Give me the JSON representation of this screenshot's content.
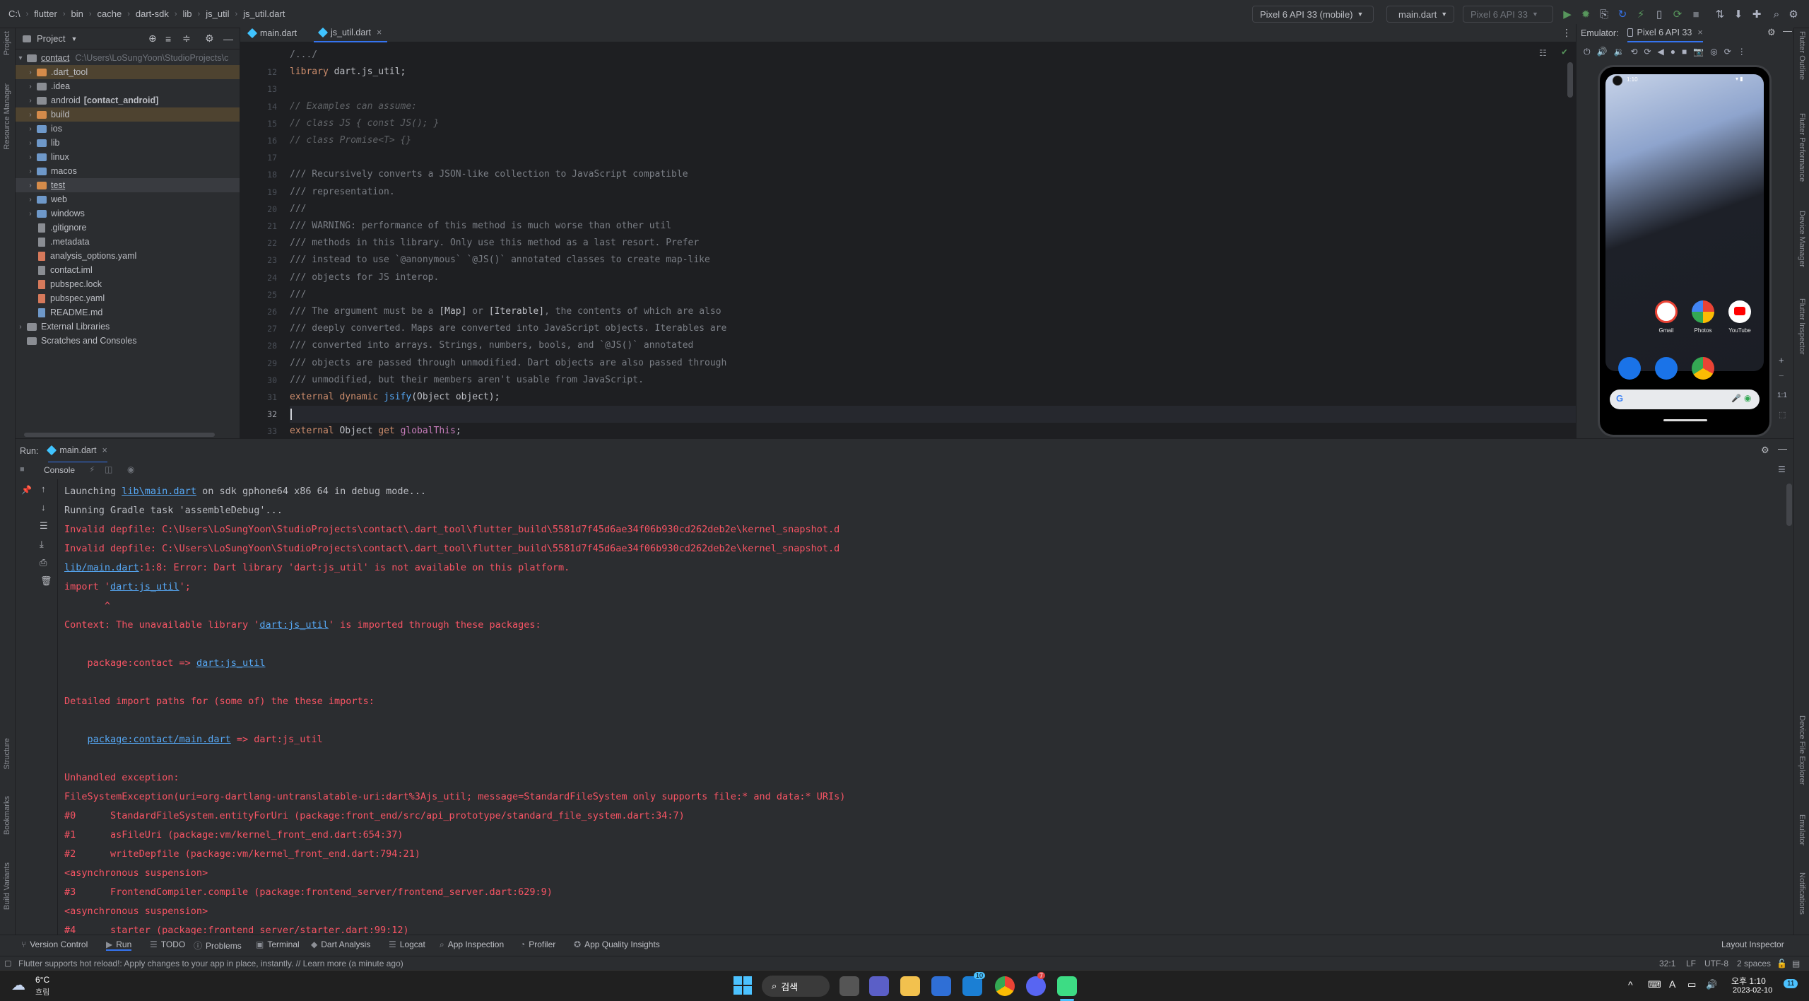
{
  "breadcrumb": [
    "C:\\",
    "flutter",
    "bin",
    "cache",
    "dart-sdk",
    "lib",
    "js_util",
    "js_util.dart"
  ],
  "toolbar": {
    "device": "Pixel 6 API 33 (mobile)",
    "config": "main.dart",
    "avd": "Pixel 6 API 33"
  },
  "left_stripe": [
    "Project",
    "Resource Manager",
    "Structure",
    "Bookmarks",
    "Build Variants"
  ],
  "right_stripe": [
    "Flutter Outline",
    "Flutter Performance",
    "Device Manager",
    "Flutter Inspector",
    "Device File Explorer",
    "Emulator",
    "Notifications"
  ],
  "project": {
    "title": "Project",
    "root": "contact",
    "root_path": "C:\\Users\\LoSungYoon\\StudioProjects\\c",
    "items": [
      {
        "label": ".dart_tool",
        "kind": "folder-orange",
        "expand": true,
        "style": "excluded"
      },
      {
        "label": ".idea",
        "kind": "folder-gray",
        "expand": true
      },
      {
        "label": "android",
        "suffix": "[contact_android]",
        "kind": "folder-gray",
        "expand": true
      },
      {
        "label": "build",
        "kind": "folder-orange",
        "expand": true,
        "style": "excluded"
      },
      {
        "label": "ios",
        "kind": "folder-blue",
        "expand": true
      },
      {
        "label": "lib",
        "kind": "folder-blue",
        "expand": true
      },
      {
        "label": "linux",
        "kind": "folder-blue",
        "expand": true
      },
      {
        "label": "macos",
        "kind": "folder-blue",
        "expand": true
      },
      {
        "label": "test",
        "kind": "folder-orange",
        "expand": true,
        "style": "sel"
      },
      {
        "label": "web",
        "kind": "folder-blue",
        "expand": true
      },
      {
        "label": "windows",
        "kind": "folder-blue",
        "expand": true
      },
      {
        "label": ".gitignore",
        "kind": "file"
      },
      {
        "label": ".metadata",
        "kind": "file"
      },
      {
        "label": "analysis_options.yaml",
        "kind": "file-yaml"
      },
      {
        "label": "contact.iml",
        "kind": "file"
      },
      {
        "label": "pubspec.lock",
        "kind": "file-yaml"
      },
      {
        "label": "pubspec.yaml",
        "kind": "file-yaml"
      },
      {
        "label": "README.md",
        "kind": "file-md"
      }
    ],
    "external": "External Libraries",
    "scratches": "Scratches and Consoles"
  },
  "editor": {
    "tabs": [
      {
        "label": "main.dart",
        "active": false
      },
      {
        "label": "js_util.dart",
        "active": true
      }
    ],
    "lines": [
      {
        "n": "",
        "segs": [
          [
            "cmt",
            "/.../"
          ]
        ]
      },
      {
        "n": "12",
        "segs": [
          [
            "kw",
            "library"
          ],
          [
            "ty",
            " dart.js_util;"
          ]
        ]
      },
      {
        "n": "13",
        "segs": []
      },
      {
        "n": "14",
        "segs": [
          [
            "cmt-i",
            "// Examples can assume:"
          ]
        ]
      },
      {
        "n": "15",
        "segs": [
          [
            "cmt-i",
            "// class JS { const JS(); }"
          ]
        ]
      },
      {
        "n": "16",
        "segs": [
          [
            "cmt-i",
            "// class Promise<T> {}"
          ]
        ]
      },
      {
        "n": "17",
        "segs": []
      },
      {
        "n": "18",
        "segs": [
          [
            "cmt",
            "/// Recursively converts a JSON-like collection to JavaScript compatible"
          ]
        ]
      },
      {
        "n": "19",
        "segs": [
          [
            "cmt",
            "/// representation."
          ]
        ]
      },
      {
        "n": "20",
        "segs": [
          [
            "cmt",
            "///"
          ]
        ]
      },
      {
        "n": "21",
        "segs": [
          [
            "cmt",
            "/// WARNING: performance of this method is much worse than other util"
          ]
        ]
      },
      {
        "n": "22",
        "segs": [
          [
            "cmt",
            "/// methods in this library. Only use this method as a last resort. Prefer"
          ]
        ]
      },
      {
        "n": "23",
        "segs": [
          [
            "cmt",
            "/// instead to use `@anonymous` `@JS()` annotated classes to create map-like"
          ]
        ]
      },
      {
        "n": "24",
        "segs": [
          [
            "cmt",
            "/// objects for JS interop."
          ]
        ]
      },
      {
        "n": "25",
        "segs": [
          [
            "cmt",
            "///"
          ]
        ]
      },
      {
        "n": "26",
        "segs": [
          [
            "cmt",
            "/// The argument must be a "
          ],
          [
            "ty",
            "[Map]"
          ],
          [
            "cmt",
            " or "
          ],
          [
            "ty",
            "[Iterable]"
          ],
          [
            "cmt",
            ", the contents of which are also"
          ]
        ]
      },
      {
        "n": "27",
        "segs": [
          [
            "cmt",
            "/// deeply converted. Maps are converted into JavaScript objects. Iterables are"
          ]
        ]
      },
      {
        "n": "28",
        "segs": [
          [
            "cmt",
            "/// converted into arrays. Strings, numbers, bools, and `@JS()` annotated"
          ]
        ]
      },
      {
        "n": "29",
        "segs": [
          [
            "cmt",
            "/// objects are passed through unmodified. Dart objects are also passed through"
          ]
        ]
      },
      {
        "n": "30",
        "segs": [
          [
            "cmt",
            "/// unmodified, but their members aren't usable from JavaScript."
          ]
        ]
      },
      {
        "n": "31",
        "segs": [
          [
            "kw",
            "external dynamic "
          ],
          [
            "fn",
            "jsify"
          ],
          [
            "ty",
            "(Object object);"
          ]
        ]
      },
      {
        "n": "32",
        "segs": [],
        "caret": true
      },
      {
        "n": "33",
        "segs": [
          [
            "kw",
            "external "
          ],
          [
            "ty",
            "Object "
          ],
          [
            "kw",
            "get "
          ],
          [
            "ref",
            "globalThis"
          ],
          [
            "ty",
            ";"
          ]
        ]
      }
    ]
  },
  "emulator": {
    "title": "Emulator:",
    "tab": "Pixel 6 API 33",
    "status_time": "1:10",
    "apps_row1": [
      {
        "label": "Gmail",
        "color": "#ffffff"
      },
      {
        "label": "Photos",
        "color": "#fbbc04"
      },
      {
        "label": "YouTube",
        "color": "#ff0000"
      }
    ],
    "apps_row2": [
      {
        "label": "",
        "color": "#1a73e8"
      },
      {
        "label": "",
        "color": "#1a73e8"
      },
      {
        "label": "",
        "color": "#ffffff"
      }
    ],
    "zoom_label": "1:1"
  },
  "run": {
    "label": "Run:",
    "tab": "main.dart",
    "console_tab": "Console",
    "lines": [
      {
        "style": "normal",
        "segs": [
          [
            "t",
            "Launching "
          ],
          [
            "lnk",
            "lib\\main.dart"
          ],
          [
            "t",
            " on sdk gphone64 x86 64 in debug mode..."
          ]
        ]
      },
      {
        "style": "normal",
        "segs": [
          [
            "t",
            "Running Gradle task 'assembleDebug'..."
          ]
        ]
      },
      {
        "style": "err",
        "segs": [
          [
            "t",
            "Invalid depfile: C:\\Users\\LoSungYoon\\StudioProjects\\contact\\.dart_tool\\flutter_build\\5581d7f45d6ae34f06b930cd262deb2e\\kernel_snapshot.d"
          ]
        ]
      },
      {
        "style": "err",
        "segs": [
          [
            "t",
            "Invalid depfile: C:\\Users\\LoSungYoon\\StudioProjects\\contact\\.dart_tool\\flutter_build\\5581d7f45d6ae34f06b930cd262deb2e\\kernel_snapshot.d"
          ]
        ]
      },
      {
        "style": "err",
        "segs": [
          [
            "lnk",
            "lib/main.dart"
          ],
          [
            "t",
            ":1:8: Error: Dart library 'dart:js_util' is not available on this platform."
          ]
        ]
      },
      {
        "style": "err",
        "segs": [
          [
            "t",
            "import '"
          ],
          [
            "lnk",
            "dart:js_util"
          ],
          [
            "t",
            "';"
          ]
        ]
      },
      {
        "style": "err",
        "segs": [
          [
            "t",
            "       ^"
          ]
        ]
      },
      {
        "style": "err",
        "segs": [
          [
            "t",
            "Context: The unavailable library '"
          ],
          [
            "lnk",
            "dart:js_util"
          ],
          [
            "t",
            "' is imported through these packages:"
          ]
        ]
      },
      {
        "style": "err",
        "segs": []
      },
      {
        "style": "err",
        "segs": [
          [
            "t",
            "    package:contact => "
          ],
          [
            "lnk",
            "dart:js_util"
          ]
        ]
      },
      {
        "style": "err",
        "segs": []
      },
      {
        "style": "err",
        "segs": [
          [
            "t",
            "Detailed import paths for (some of) the these imports:"
          ]
        ]
      },
      {
        "style": "err",
        "segs": []
      },
      {
        "style": "err",
        "segs": [
          [
            "t",
            "    "
          ],
          [
            "lnk",
            "package:contact/main.dart"
          ],
          [
            "t",
            " => dart:js_util"
          ]
        ]
      },
      {
        "style": "err",
        "segs": []
      },
      {
        "style": "err",
        "segs": [
          [
            "t",
            "Unhandled exception:"
          ]
        ]
      },
      {
        "style": "err",
        "segs": [
          [
            "t",
            "FileSystemException(uri=org-dartlang-untranslatable-uri:dart%3Ajs_util; message=StandardFileSystem only supports file:* and data:* URIs)"
          ]
        ]
      },
      {
        "style": "err",
        "segs": [
          [
            "t",
            "#0      StandardFileSystem.entityForUri (package:front_end/src/api_prototype/standard_file_system.dart:34:7)"
          ]
        ]
      },
      {
        "style": "err",
        "segs": [
          [
            "t",
            "#1      asFileUri (package:vm/kernel_front_end.dart:654:37)"
          ]
        ]
      },
      {
        "style": "err",
        "segs": [
          [
            "t",
            "#2      writeDepfile (package:vm/kernel_front_end.dart:794:21)"
          ]
        ]
      },
      {
        "style": "err",
        "segs": [
          [
            "t",
            "<asynchronous suspension>"
          ]
        ]
      },
      {
        "style": "err",
        "segs": [
          [
            "t",
            "#3      FrontendCompiler.compile (package:frontend_server/frontend_server.dart:629:9)"
          ]
        ]
      },
      {
        "style": "err",
        "segs": [
          [
            "t",
            "<asynchronous suspension>"
          ]
        ]
      },
      {
        "style": "err",
        "segs": [
          [
            "t",
            "#4      starter (package:frontend_server/starter.dart:99:12)"
          ]
        ]
      }
    ]
  },
  "bottom_tools": [
    "Version Control",
    "Run",
    "TODO",
    "Problems",
    "Terminal",
    "Dart Analysis",
    "Logcat",
    "App Inspection",
    "Profiler",
    "App Quality Insights"
  ],
  "layout_inspector": "Layout Inspector",
  "status": {
    "message": "Flutter supports hot reload!: Apply changes to your app in place, instantly. // Learn more (a minute ago)",
    "position": "32:1",
    "line_sep": "LF",
    "encoding": "UTF-8",
    "indent": "2 spaces"
  },
  "taskbar": {
    "weather_temp": "6°C",
    "weather_desc": "흐림",
    "search": "검색",
    "badge_mail": "10",
    "badge_discord": "7",
    "time": "오후 1:10",
    "date": "2023-02-10",
    "notif": "11",
    "ime": "A"
  }
}
